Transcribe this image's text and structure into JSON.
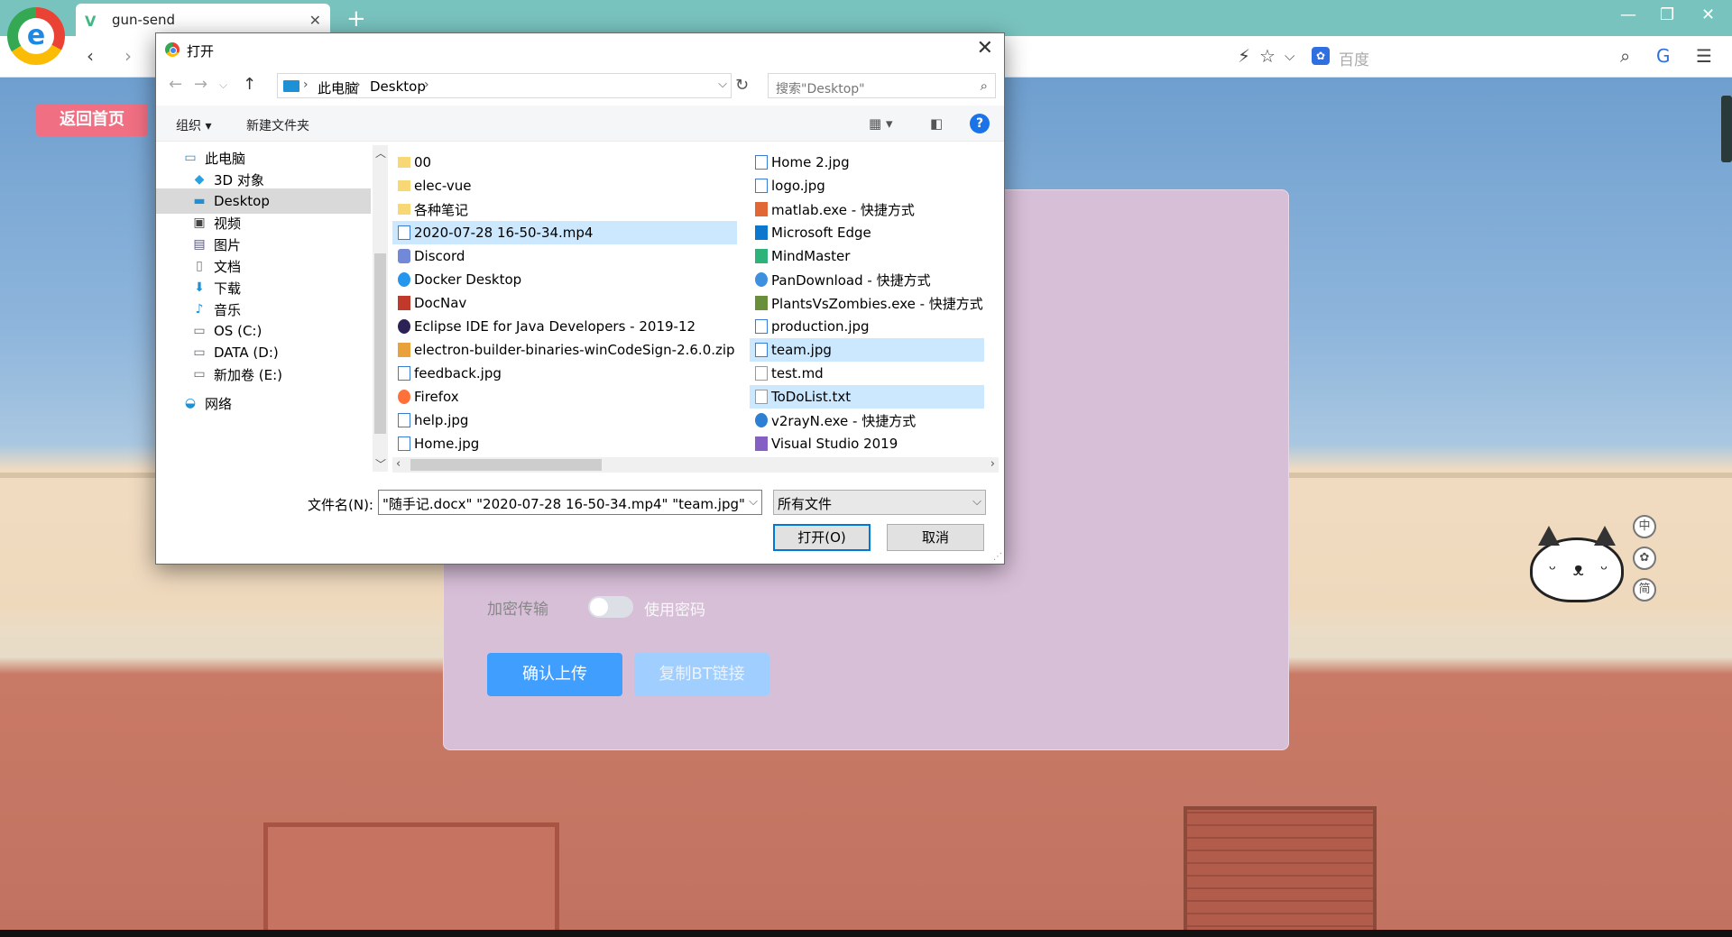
{
  "browser": {
    "tab_title": "gun-send",
    "new_tab": "+",
    "search_engine": "百度",
    "colors": {
      "tabstrip": "#79c3bf",
      "toolbar": "#ffffff"
    }
  },
  "page": {
    "home_button": "返回首页",
    "encrypt_label": "加密传输",
    "password_label": "使用密码",
    "upload_button": "确认上传",
    "copy_button": "复制BT链接",
    "side_chips": [
      "中",
      "✿",
      "简"
    ],
    "colors": {
      "card": "#d8bfd8",
      "upload": "#409eff",
      "copy": "#a0cfff",
      "home": "#f06f82"
    }
  },
  "dialog": {
    "title": "打开",
    "breadcrumb": [
      "此电脑",
      "Desktop"
    ],
    "search_placeholder": "搜索\"Desktop\"",
    "organize": "组织 ▾",
    "new_folder": "新建文件夹",
    "nav_items": [
      {
        "label": "此电脑",
        "icon": "computer-icon"
      },
      {
        "label": "3D 对象",
        "icon": "3d-objects-icon"
      },
      {
        "label": "Desktop",
        "icon": "desktop-icon",
        "selected": true
      },
      {
        "label": "视频",
        "icon": "video-icon"
      },
      {
        "label": "图片",
        "icon": "pictures-icon"
      },
      {
        "label": "文档",
        "icon": "documents-icon"
      },
      {
        "label": "下载",
        "icon": "download-icon"
      },
      {
        "label": "音乐",
        "icon": "music-icon"
      },
      {
        "label": "OS (C:)",
        "icon": "drive-icon"
      },
      {
        "label": "DATA (D:)",
        "icon": "drive-icon"
      },
      {
        "label": "新加卷 (E:)",
        "icon": "drive-icon"
      },
      {
        "label": "网络",
        "icon": "network-icon"
      }
    ],
    "files_col1": [
      {
        "name": "00",
        "type": "folder"
      },
      {
        "name": "elec-vue",
        "type": "folder"
      },
      {
        "name": "各种笔记",
        "type": "folder"
      },
      {
        "name": "2020-07-28 16-50-34.mp4",
        "type": "video",
        "selected": true
      },
      {
        "name": "Discord",
        "type": "shortcut"
      },
      {
        "name": "Docker Desktop",
        "type": "shortcut"
      },
      {
        "name": "DocNav",
        "type": "shortcut"
      },
      {
        "name": "Eclipse IDE for Java Developers - 2019-12",
        "type": "shortcut"
      },
      {
        "name": "electron-builder-binaries-winCodeSign-2.6.0.zip",
        "type": "archive"
      },
      {
        "name": "feedback.jpg",
        "type": "image"
      },
      {
        "name": "Firefox",
        "type": "shortcut"
      },
      {
        "name": "help.jpg",
        "type": "image"
      },
      {
        "name": "Home.jpg",
        "type": "image"
      }
    ],
    "files_col2": [
      {
        "name": "Home 2.jpg",
        "type": "image"
      },
      {
        "name": "logo.jpg",
        "type": "image"
      },
      {
        "name": "matlab.exe - 快捷方式",
        "type": "shortcut"
      },
      {
        "name": "Microsoft Edge",
        "type": "shortcut"
      },
      {
        "name": "MindMaster",
        "type": "shortcut"
      },
      {
        "name": "PanDownload - 快捷方式",
        "type": "shortcut"
      },
      {
        "name": "PlantsVsZombies.exe - 快捷方式",
        "type": "shortcut"
      },
      {
        "name": "production.jpg",
        "type": "image"
      },
      {
        "name": "team.jpg",
        "type": "image",
        "selected": true
      },
      {
        "name": "test.md",
        "type": "text"
      },
      {
        "name": "ToDoList.txt",
        "type": "text",
        "selected": true
      },
      {
        "name": "v2rayN.exe - 快捷方式",
        "type": "shortcut"
      },
      {
        "name": "Visual Studio 2019",
        "type": "shortcut"
      }
    ],
    "filename_label": "文件名(N):",
    "filename_value": "\"随手记.docx\" \"2020-07-28 16-50-34.mp4\" \"team.jpg\"",
    "filetype_value": "所有文件",
    "open_button": "打开(O)",
    "cancel_button": "取消",
    "colors": {
      "selection": "#cce8ff",
      "accent": "#0078d7"
    }
  }
}
